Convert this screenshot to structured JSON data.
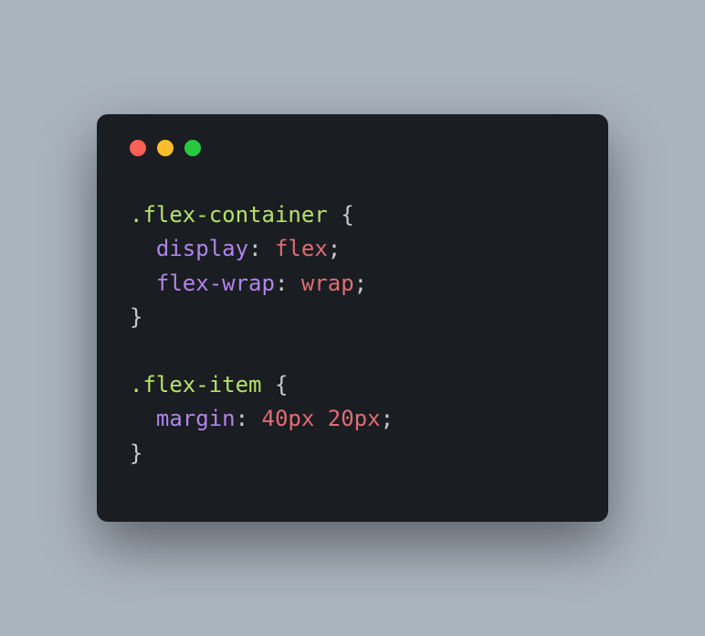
{
  "code": {
    "rule1": {
      "selector": ".flex-container",
      "decl1": {
        "prop": "display",
        "value": "flex"
      },
      "decl2": {
        "prop": "flex-wrap",
        "value": "wrap"
      }
    },
    "rule2": {
      "selector": ".flex-item",
      "decl1": {
        "prop": "margin",
        "value": "40px 20px"
      }
    }
  },
  "punct": {
    "space": " ",
    "open": "{",
    "close": "}",
    "colon": ":",
    "semi": ";",
    "indent": "  "
  }
}
